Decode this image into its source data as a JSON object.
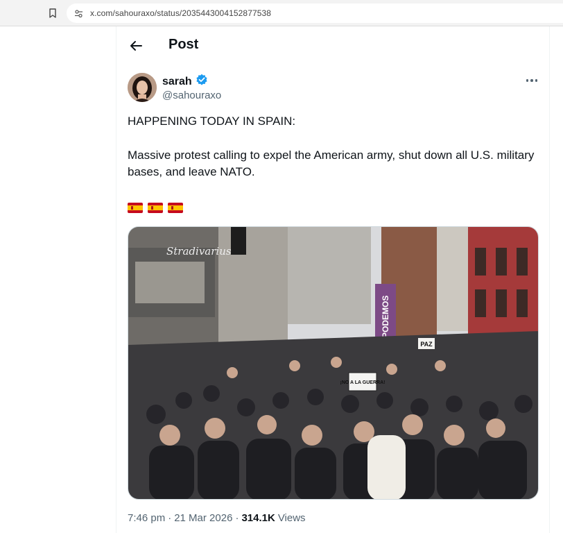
{
  "browser": {
    "url": "x.com/sahouraxo/status/2035443004152877538"
  },
  "header": {
    "title": "Post"
  },
  "author": {
    "name": "sarah",
    "handle": "@sahouraxo",
    "verified": true
  },
  "tweet": {
    "line1": "HAPPENING TODAY IN SPAIN:",
    "line2": "Massive protest calling to expel the American army, shut down all U.S. military bases, and leave NATO.",
    "flags": [
      "flag-spain",
      "flag-spain",
      "flag-spain"
    ],
    "image_signs": {
      "podemos": "PODEMOS",
      "no_guerra": "¡NO A LA GUERRA!",
      "paz": "PAZ",
      "store_sign": "Stradivarius"
    }
  },
  "meta": {
    "time": "7:46 pm",
    "separator1": "·",
    "date": "21 Mar 2026",
    "separator2": "·",
    "views_count": "314.1K",
    "views_label": "Views"
  },
  "colors": {
    "verified_badge": "#1d9bf0",
    "text_primary": "#0f1419",
    "text_secondary": "#536471"
  }
}
